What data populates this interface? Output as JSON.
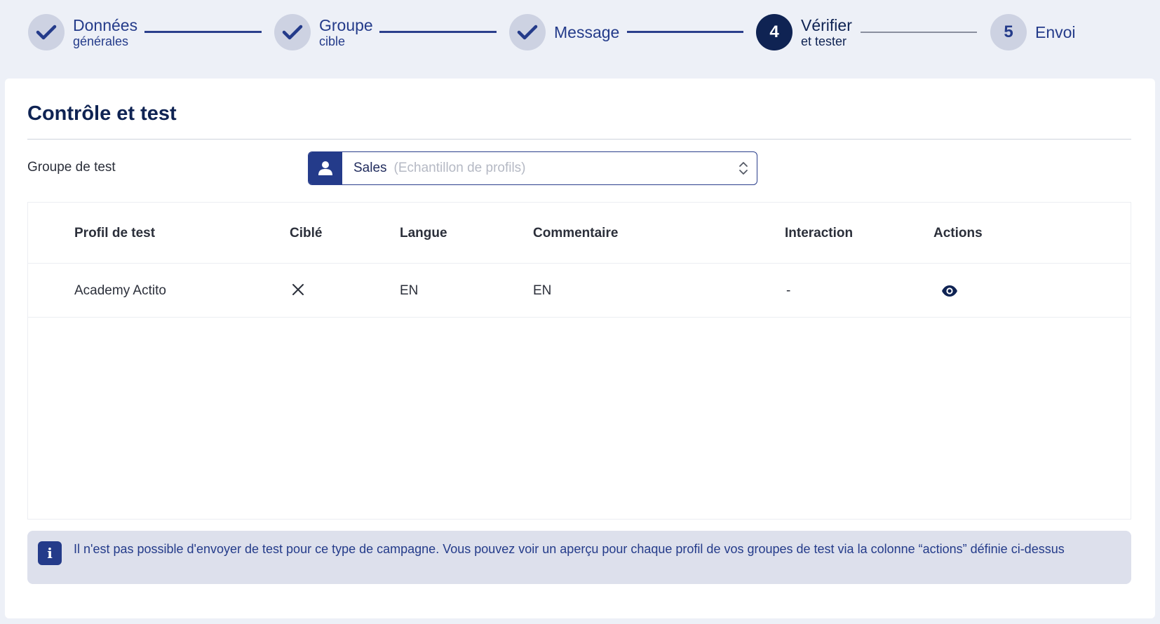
{
  "stepper": {
    "steps": [
      {
        "title": "Données",
        "subtitle": "générales",
        "state": "done"
      },
      {
        "title": "Groupe",
        "subtitle": "cible",
        "state": "done"
      },
      {
        "title": "Message",
        "subtitle": "",
        "state": "done"
      },
      {
        "title": "Vérifier",
        "subtitle": "et tester",
        "state": "active",
        "number": "4"
      },
      {
        "title": "Envoi",
        "subtitle": "",
        "state": "pending",
        "number": "5"
      }
    ]
  },
  "card": {
    "title": "Contrôle et test",
    "test_group_label": "Groupe de test",
    "select": {
      "value": "Sales",
      "hint": "(Echantillon de profils)",
      "icon": "user-icon"
    }
  },
  "table": {
    "headers": {
      "profile": "Profil de test",
      "targeted": "Ciblé",
      "language": "Langue",
      "comment": "Commentaire",
      "interaction": "Interaction",
      "actions": "Actions"
    },
    "rows": [
      {
        "profile": "Academy Actito",
        "targeted_icon": "cross-icon",
        "language": "EN",
        "comment": "EN",
        "interaction": "-",
        "action_icon": "eye-icon"
      }
    ]
  },
  "info": {
    "icon": "info-icon",
    "glyph": "i",
    "text": "Il n'est pas possible d'envoyer de test pour ce type de campagne. Vous pouvez voir un aperçu pour chaque profil de vos groupes de test via la colonne “actions” définie ci-dessus"
  },
  "colors": {
    "navy": "#0f2353",
    "primary": "#243b8a",
    "background": "#edf0f7",
    "info_bg": "#dde0ec"
  }
}
